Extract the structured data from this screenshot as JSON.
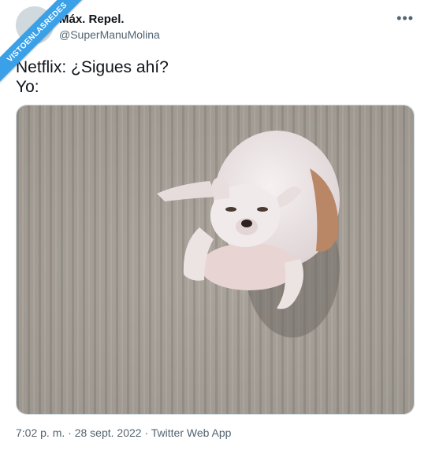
{
  "watermark": "VISTOENLASREDES",
  "author": {
    "name": "Máx. Repel.",
    "handle": "@SuperManuMolina"
  },
  "more_icon": "more-horizontal-icon",
  "tweet_text": "Netflix: ¿Sigues ahí?\nYo:",
  "media": {
    "description_icon": "photo-dog-meme"
  },
  "meta": {
    "time": "7:02 p. m.",
    "separator": " · ",
    "date": "28 sept. 2022",
    "source": "Twitter Web App"
  },
  "colors": {
    "text": "#0f1419",
    "secondary": "#536471",
    "ribbon": "#3aa0e8",
    "pavement": "#a9a39b"
  }
}
